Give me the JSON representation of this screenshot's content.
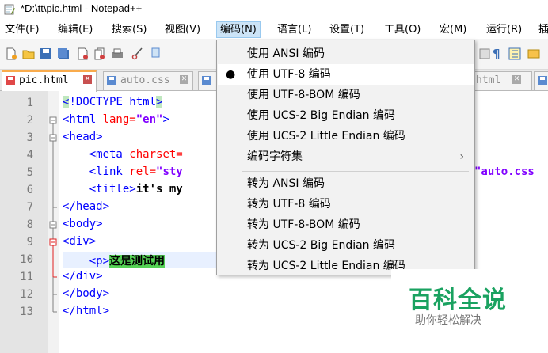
{
  "window": {
    "title": "*D:\\tt\\pic.html - Notepad++"
  },
  "menubar": {
    "items": [
      {
        "label": "文件(F)"
      },
      {
        "label": "编辑(E)"
      },
      {
        "label": "搜索(S)"
      },
      {
        "label": "视图(V)"
      },
      {
        "label": "编码(N)"
      },
      {
        "label": "语言(L)"
      },
      {
        "label": "设置(T)"
      },
      {
        "label": "工具(O)"
      },
      {
        "label": "宏(M)"
      },
      {
        "label": "运行(R)"
      },
      {
        "label": "插"
      }
    ]
  },
  "tabs": [
    {
      "label": "pic.html"
    },
    {
      "label": "auto.css"
    },
    {
      "label": "html"
    }
  ],
  "editor": {
    "line_numbers": [
      "1",
      "2",
      "3",
      "4",
      "5",
      "6",
      "7",
      "8",
      "9",
      "10",
      "11",
      "12",
      "13"
    ],
    "lines": {
      "l1a": "<",
      "l1b": "!DOCTYPE html",
      "l1c": ">",
      "l2a": "<html ",
      "l2b": "lang=",
      "l2c": "\"en\"",
      "l2d": ">",
      "l3": "<head>",
      "l4a": "    <meta ",
      "l4b": "charset=",
      "l5a": "    <link ",
      "l5b": "rel=",
      "l5c": "\"sty",
      "l5d": "\"auto.css",
      "l6a": "    <title>",
      "l6b": "it's my",
      "l7": "</head>",
      "l8": "<body>",
      "l9": "<div>",
      "l10a": "    <p>",
      "l10b": "这是测试用",
      "l11": "</div>",
      "l12": "</body>",
      "l13": "</html>"
    }
  },
  "encoding_menu": {
    "items": [
      {
        "label": "使用 ANSI 编码",
        "checked": false
      },
      {
        "label": "使用 UTF-8 编码",
        "checked": true
      },
      {
        "label": "使用 UTF-8-BOM 编码",
        "checked": false
      },
      {
        "label": "使用 UCS-2 Big Endian 编码",
        "checked": false
      },
      {
        "label": "使用 UCS-2 Little Endian 编码",
        "checked": false
      },
      {
        "label": "编码字符集",
        "submenu": true
      },
      {
        "label": "转为 ANSI 编码"
      },
      {
        "label": "转为 UTF-8 编码"
      },
      {
        "label": "转为 UTF-8-BOM 编码"
      },
      {
        "label": "转为 UCS-2 Big Endian 编码"
      },
      {
        "label": "转为 UCS-2 Little Endian 编码"
      }
    ],
    "checked_bullet": "●",
    "submenu_arrow": "›"
  },
  "watermark": {
    "title": "百科全说",
    "subtitle": "助你轻松解决"
  },
  "colors": {
    "tag": "#0000ff",
    "attribute": "#ff0000",
    "string": "#8000ff",
    "selection_highlight": "#55d255",
    "watermark_green": "#1aa260"
  }
}
